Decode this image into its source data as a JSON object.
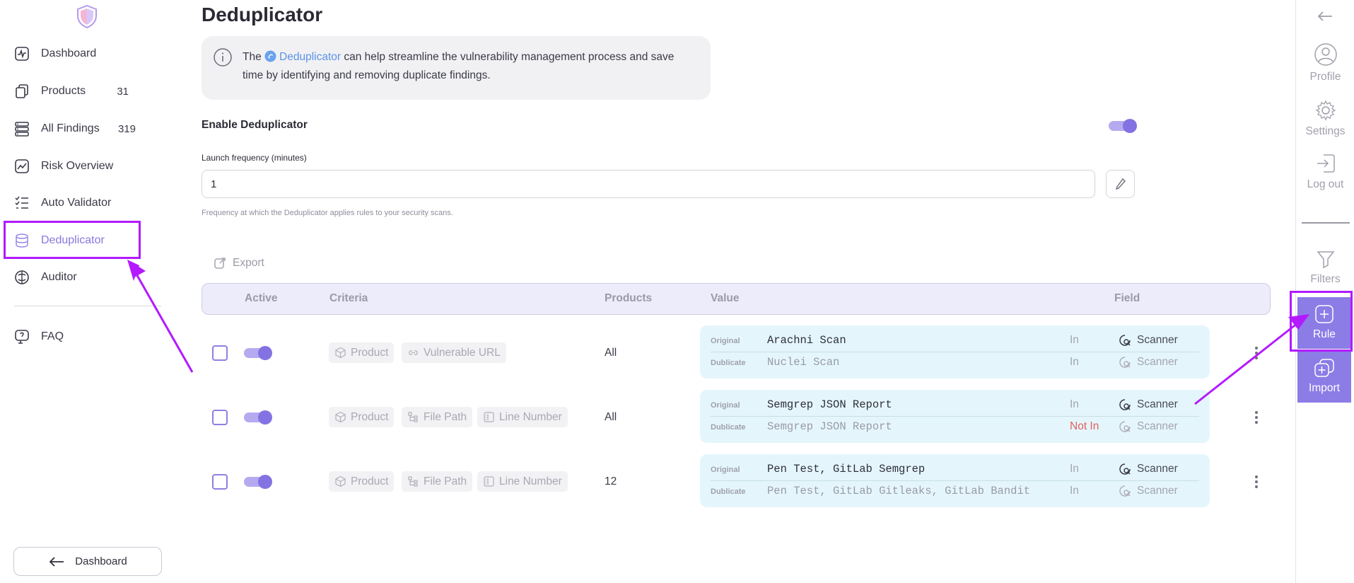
{
  "sidebar": {
    "items": [
      {
        "label": "Dashboard",
        "count": "",
        "icon": "pulse-icon"
      },
      {
        "label": "Products",
        "count": "31",
        "icon": "layers-icon"
      },
      {
        "label": "All Findings",
        "count": "319",
        "icon": "server-icon"
      },
      {
        "label": "Risk Overview",
        "count": "",
        "icon": "trend-icon"
      },
      {
        "label": "Auto Validator",
        "count": "",
        "icon": "checklist-icon"
      },
      {
        "label": "Deduplicator",
        "count": "",
        "icon": "stack-icon"
      },
      {
        "label": "Auditor",
        "count": "",
        "icon": "auditor-icon"
      },
      {
        "label": "FAQ",
        "count": "",
        "icon": "faq-icon"
      }
    ],
    "active": "Deduplicator",
    "back_button": "Dashboard"
  },
  "main": {
    "title": "Deduplicator",
    "info": {
      "before": "The",
      "link": "Deduplicator",
      "after": "can help streamline the vulnerability management process and save time by identifying and removing duplicate findings."
    },
    "enable_label": "Enable Deduplicator",
    "enabled": true,
    "frequency_label": "Launch frequency (minutes)",
    "frequency_value": "1",
    "frequency_help": "Frequency at which the Deduplicator applies rules to your security scans.",
    "export_label": "Export"
  },
  "table": {
    "headers": {
      "active": "Active",
      "criteria": "Criteria",
      "products": "Products",
      "value": "Value",
      "field": "Field"
    },
    "original_tag": "Original",
    "duplicate_tag": "Dublicate",
    "rows": [
      {
        "active": true,
        "criteria": [
          "Product",
          "Vulnerable URL"
        ],
        "products": "All",
        "original": {
          "value": "Arachni Scan",
          "op": "In",
          "field": "Scanner"
        },
        "duplicate": {
          "value": "Nuclei Scan",
          "op": "In",
          "field": "Scanner"
        }
      },
      {
        "active": true,
        "criteria": [
          "Product",
          "File Path",
          "Line Number"
        ],
        "products": "All",
        "original": {
          "value": "Semgrep JSON Report",
          "op": "In",
          "field": "Scanner"
        },
        "duplicate": {
          "value": "Semgrep JSON Report",
          "op": "Not In",
          "field": "Scanner"
        }
      },
      {
        "active": true,
        "criteria": [
          "Product",
          "File Path",
          "Line Number"
        ],
        "products": "12",
        "original": {
          "value": "Pen Test, GitLab Semgrep",
          "op": "In",
          "field": "Scanner"
        },
        "duplicate": {
          "value": "Pen Test, GitLab Gitleaks, GitLab Bandit",
          "op": "In",
          "field": "Scanner"
        }
      }
    ]
  },
  "right_panel": {
    "profile": "Profile",
    "settings": "Settings",
    "logout": "Log out",
    "filters": "Filters",
    "rule": "Rule",
    "import": "Import"
  },
  "colors": {
    "accent": "#8c7ce6",
    "annotation": "#b31aff",
    "info_link": "#5b93e6",
    "value_box": "#e4f6fc",
    "not_in": "#e06060"
  }
}
